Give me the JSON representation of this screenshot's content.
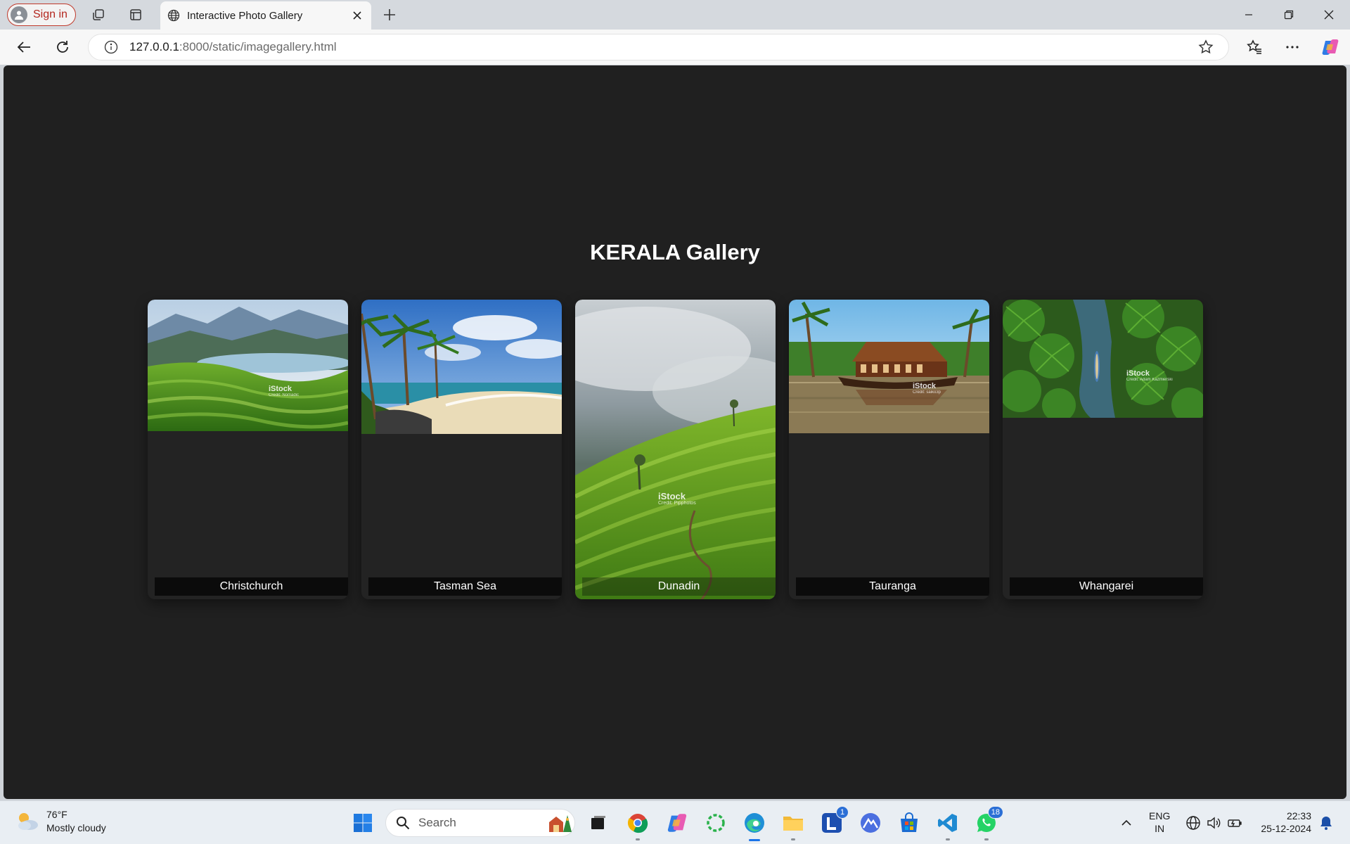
{
  "browser": {
    "signin_label": "Sign in",
    "tab_title": "Interactive Photo Gallery",
    "url_host": "127.0.0.1",
    "url_path": ":8000/static/imagegallery.html"
  },
  "page": {
    "title": "KERALA Gallery",
    "cards": [
      {
        "caption": "Christchurch",
        "watermark": "iStock",
        "watermark_credit": "Credit: Nomadic"
      },
      {
        "caption": "Tasman Sea",
        "watermark": "",
        "watermark_credit": ""
      },
      {
        "caption": "Dunadin",
        "watermark": "iStock",
        "watermark_credit": "Credit: Pipphotos"
      },
      {
        "caption": "Tauranga",
        "watermark": "iStock",
        "watermark_credit": "Credit: saiko3p"
      },
      {
        "caption": "Whangarei",
        "watermark": "iStock",
        "watermark_credit": "Credit: Adam Kazmierski"
      }
    ]
  },
  "taskbar": {
    "weather_temp": "76°F",
    "weather_desc": "Mostly cloudy",
    "search_placeholder": "Search",
    "lang_line1": "ENG",
    "lang_line2": "IN",
    "time": "22:33",
    "date": "25-12-2024",
    "badges": {
      "l_app": "1",
      "whatsapp": "18"
    }
  },
  "colors": {
    "page_bg": "#202020",
    "caption_bg": "#0b0b0b",
    "signin_accent": "#b3261e"
  },
  "icons": [
    "user-icon",
    "workspaces-icon",
    "tab-actions-icon",
    "globe-icon",
    "close-icon",
    "plus-icon",
    "minimize-icon",
    "restore-icon",
    "back-icon",
    "refresh-icon",
    "info-icon",
    "star-icon",
    "favorites-icon",
    "more-icon",
    "copilot-icon",
    "weather-icon",
    "windows-icon",
    "search-icon"
  ]
}
